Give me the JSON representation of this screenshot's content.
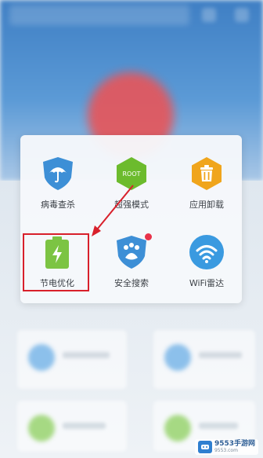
{
  "panel": {
    "items": [
      {
        "label": "病毒查杀",
        "icon": "umbrella-shield-icon"
      },
      {
        "label": "超强模式",
        "icon": "root-hexagon-icon",
        "badge_text": "ROOT"
      },
      {
        "label": "应用卸载",
        "icon": "trash-hexagon-icon"
      },
      {
        "label": "节电优化",
        "icon": "battery-icon"
      },
      {
        "label": "安全搜索",
        "icon": "paw-shield-icon"
      },
      {
        "label": "WiFi雷达",
        "icon": "wifi-radar-icon"
      }
    ]
  },
  "watermark": {
    "brand": "9553手游网",
    "domain": "9553.com"
  },
  "colors": {
    "highlight": "#d8202b",
    "shield_blue": "#3d8fd6",
    "root_green": "#6cbb2d",
    "trash_orange": "#f0a51c",
    "battery_green": "#7cc443",
    "wifi_blue": "#3a9ae0"
  }
}
